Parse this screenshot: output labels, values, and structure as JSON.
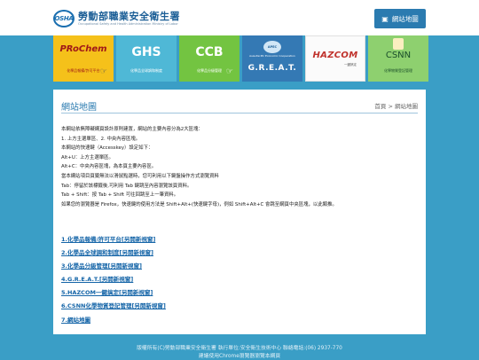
{
  "header": {
    "logo_mark": "OSHA",
    "logo_title": "勞動部職業安全衛生署",
    "logo_subtitle": "Occupational Safety and Health Administration Ministry of Labor",
    "sitemap_label": "網站地圖",
    "sitemap_icon": "sitemap-icon"
  },
  "banners": [
    {
      "big": "PRoChem",
      "small": "化學品報備/許可平台"
    },
    {
      "big": "GHS",
      "small": "化學品全球調和制度"
    },
    {
      "big": "CCB",
      "small": "化學品分級管理"
    },
    {
      "circle": "APEC",
      "sub": "Asia-Pacific Economic Cooperation",
      "big": "G.R.E.A.T."
    },
    {
      "big": "HAZCOM",
      "small": "一鍵搞定"
    },
    {
      "big": "CSNN",
      "small": "化學物質登記管理"
    }
  ],
  "panel": {
    "title": "網站地圖",
    "breadcrumb": "首頁 > 網站地圖",
    "paragraphs": [
      "本網站依無障礙網頁設計原則建置，網站的主要內容分為2大區塊：",
      "1. 上方主選單區、2. 中央內容區塊。",
      "本網站的快速鍵（Accesskey）設定如下：",
      "Alt+U：上方主選單區。",
      "Alt+C：中央內容區塊，為本頁主要內容區。",
      "當本網站項目頁籤無法以滑鼠點選時，您可利用以下鍵盤操作方式瀏覽資料",
      "Tab：停留於該標籤後,可利用 Tab 鍵跳至內容瀏覽該頁資料。",
      "Tab + Shift：按 Tab + Shift 可往回跳至上一筆資料。",
      "如果您的瀏覽器是 Firefox，快速鍵的使用方法是 Shift+Alt+(快速鍵字母)，例如 Shift+Alt+C 會跳至網頁中央區塊，以此類推。"
    ],
    "links": [
      "1.化學品報備/許可平台[另開新視窗]",
      "2.化學品全球調和制度[另開新視窗]",
      "3.化學品分級管理[另開新視窗]",
      "4.G.R.E.A.T.[另開新視窗]",
      "5.HAZCOM一鍵搞定[另開新視窗]",
      "6.CSNN化學物質登記管理[另開新視窗]",
      "7.網站地圖"
    ]
  },
  "footer": {
    "line1": "版權所有(C)勞動部職業安全衛生署    執行單位:安全衛生技術中心    聯絡電話:(06) 2937-770",
    "line2": "建議使用Chrome瀏覽器瀏覽本網頁"
  }
}
